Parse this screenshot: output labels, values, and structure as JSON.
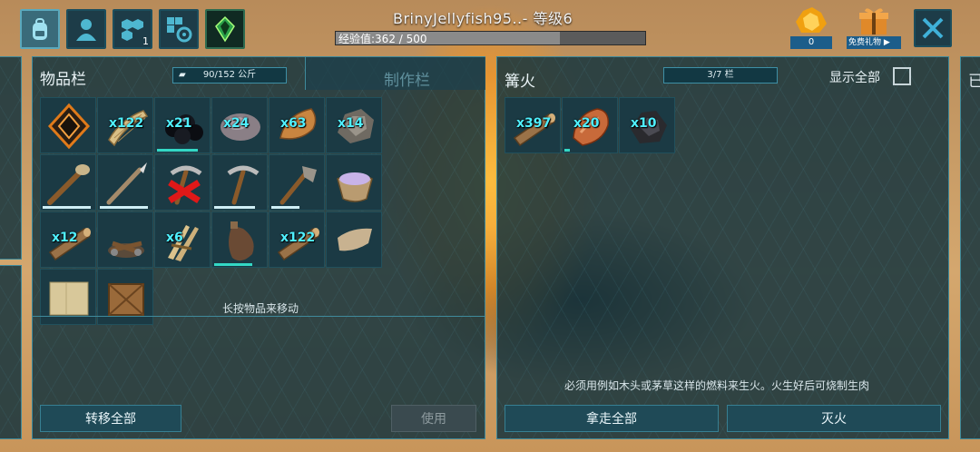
{
  "header": {
    "player_title": "BrinyJellyfish95..- 等级6",
    "xp_text": "经验值:362 / 500",
    "xp_progress": 0.724,
    "tribe_badge": "1",
    "currency_count": "0",
    "gift_label": "免费礼物",
    "icons": [
      "backpack-icon",
      "player-icon",
      "tribe-icon",
      "engram-icon",
      "crystal-icon",
      "amber-icon",
      "gift-icon",
      "close-icon"
    ]
  },
  "inventory": {
    "title": "物品栏",
    "weight": "90/152 公斤",
    "crafting_tab": "制作栏",
    "hint": "长按物品来移动",
    "transfer_all": "转移全部",
    "use": "使用",
    "slots": [
      {
        "icon": "implant-icon",
        "qty": ""
      },
      {
        "icon": "thatch-icon",
        "qty": "x122"
      },
      {
        "icon": "berries-icon",
        "qty": "x21",
        "bar": 0.8
      },
      {
        "icon": "stone-icon",
        "qty": "x24"
      },
      {
        "icon": "hide-icon",
        "qty": "x63"
      },
      {
        "icon": "flint-icon",
        "qty": "x14"
      },
      {
        "icon": "torch-icon",
        "qty": "",
        "bar": 0.95
      },
      {
        "icon": "spear-icon",
        "qty": "",
        "bar": 0.95
      },
      {
        "icon": "pick-broken-icon",
        "qty": "",
        "bar": 0.0
      },
      {
        "icon": "pick-icon",
        "qty": "",
        "bar": 0.8
      },
      {
        "icon": "hatchet-icon",
        "qty": "",
        "bar": 0.55
      },
      {
        "icon": "mortar-icon",
        "qty": ""
      },
      {
        "icon": "wood-icon",
        "qty": "x12"
      },
      {
        "icon": "campfire-icon",
        "qty": ""
      },
      {
        "icon": "thatch-bundle-icon",
        "qty": "x6"
      },
      {
        "icon": "waterskin-icon",
        "qty": "",
        "bar": 0.75
      },
      {
        "icon": "wood-icon",
        "qty": "x122"
      },
      {
        "icon": "cloth-icon",
        "qty": ""
      },
      {
        "icon": "paper-icon",
        "qty": ""
      },
      {
        "icon": "crate-icon",
        "qty": ""
      }
    ]
  },
  "campfire": {
    "title": "篝火",
    "slots_text": "3/7 栏",
    "show_all": "显示全部",
    "hint": "必须用例如木头或茅草这样的燃料来生火。火生好后可烧制生肉",
    "take_all": "拿走全部",
    "extinguish": "灭火",
    "slots": [
      {
        "icon": "wood-icon",
        "qty": "x397"
      },
      {
        "icon": "meat-icon",
        "qty": "x20",
        "bar": 0.1
      },
      {
        "icon": "charcoal-icon",
        "qty": "x10"
      }
    ]
  },
  "right_panel": {
    "title_fragment": "已"
  },
  "colors": {
    "accent": "#4ff0ff",
    "panel": "#16343e",
    "border": "#3f8a9b",
    "bar": "#33d8c5"
  }
}
